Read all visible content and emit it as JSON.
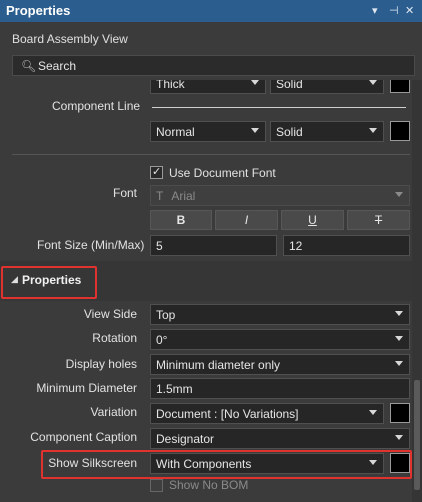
{
  "panel": {
    "title": "Properties",
    "pin_icon": "pin-icon",
    "close_icon": "close-icon",
    "menu_icon": "chevron-down-icon"
  },
  "view": {
    "subtitle": "Board Assembly View"
  },
  "search": {
    "placeholder": "Search"
  },
  "line_style": {
    "top_row": {
      "left": "Thick",
      "right": "Solid"
    },
    "component_line_label": "Component Line",
    "row": {
      "left": "Normal",
      "right": "Solid"
    }
  },
  "font": {
    "use_document_font_label": "Use Document Font",
    "use_document_font_checked": true,
    "label": "Font",
    "font_name": "Arial",
    "font_name_icon": "T",
    "style_buttons": [
      "B",
      "I",
      "U",
      "T"
    ],
    "size_label": "Font Size (Min/Max)",
    "min": "5",
    "max": "12"
  },
  "section": {
    "title": "Properties"
  },
  "properties": {
    "view_side": {
      "label": "View Side",
      "value": "Top"
    },
    "rotation": {
      "label": "Rotation",
      "value": "0°"
    },
    "display_holes": {
      "label": "Display holes",
      "value": "Minimum diameter only"
    },
    "min_diameter": {
      "label": "Minimum Diameter",
      "value": "1.5mm"
    },
    "variation": {
      "label": "Variation",
      "value": "Document : [No Variations]"
    },
    "component_caption": {
      "label": "Component Caption",
      "value": "Designator"
    },
    "show_silkscreen": {
      "label": "Show Silkscreen",
      "value": "With Components"
    },
    "show_no_bom": {
      "label": "Show No BOM"
    }
  },
  "colors": {
    "titlebar": "#2b5d8e",
    "highlight": "#e0322f"
  }
}
